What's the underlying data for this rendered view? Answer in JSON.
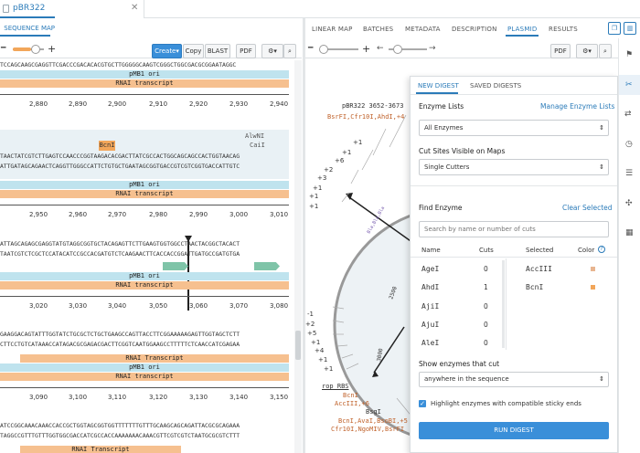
{
  "tab": {
    "title": "pBR322"
  },
  "left": {
    "title": "SEQUENCE MAP",
    "buttons": {
      "create": "Create",
      "copy": "Copy",
      "blast": "BLAST",
      "pdf": "PDF"
    }
  },
  "right_tabs": [
    "LINEAR MAP",
    "BATCHES",
    "METADATA",
    "DESCRIPTION",
    "PLASMID",
    "RESULTS"
  ],
  "right": {
    "pdf": "PDF"
  },
  "blocks": [
    {
      "ticks": [
        "2,880",
        "2,890",
        "2,900",
        "2,910",
        "2,920",
        "2,930",
        "2,940"
      ]
    },
    {
      "ticks": [
        "2,950",
        "2,960",
        "2,970",
        "2,980",
        "2,990",
        "3,000",
        "3,010"
      ]
    },
    {
      "ticks": [
        "3,020",
        "3,030",
        "3,040",
        "3,050",
        "3,060",
        "3,070",
        "3,080"
      ]
    },
    {
      "ticks": [
        "3,090",
        "3,100",
        "3,110",
        "3,120",
        "3,130",
        "3,140",
        "3,150"
      ]
    }
  ],
  "seqs": {
    "s0": "TCCAGCAAGCGAGGTTCGACCCGACACACGTGCTTGGGGGCAAGTCGGGCTGGCGACGCGGAATAGGC",
    "s1": "TAACTATCGTCTTGAGTCCAACCCGGTAAGACACGACTTATCGCCACTGGCAGCAGCCACTGGTAACAG",
    "s2": "ATTGATAGCAGAACTCAGGTTGGGCCATTCTGTGCTGAATAGCGGTGACCGTCGTCGGTGACCATTGTC",
    "s3": "ATTAGCAGAGCGAGGTATGTAGGCGGTGCTACAGAGTTCTTGAAGTGGTGGCCTAACTACGGCTACACT",
    "s4": "TAATCGTCTCGCTCCATACATCCGCCACGATGTCTCAAGAACTTCACCACCGGATTGATGCCGATGTGA",
    "s5": "GAAGGACAGTATTTGGTATCTGCGCTCTGCTGAAGCCAGTTACCTTCGGAAAAAGAGTTGGTAGCTCTT",
    "s6": "CTTCCTGTCATAAACCATAGACGCGAGACGACTTCGGTCAATGGAAGCCTTTTTCTCAACCATCGAGAA",
    "s7": "ATCCGGCAAACAAACCACCGCTGGTAGCGGTGGTTTTTTTGTTTGCAAGCAGCAGATTACGCGCAGAAA",
    "s8": "TAGGCCGTTTGTTTGGTGGCGACCATCGCCACCAAAAAAACAAACGTTCGTCGTCTAATGCGCGTCTTT"
  },
  "features": {
    "ori": "pMB1 ori",
    "rnai": "RNAI transcript",
    "rnai2": "RNAI Transcript",
    "bcni": "BcnI",
    "alwni": "AlwNI",
    "caii": "CaiI"
  },
  "plasmid": {
    "title": "pBR322 3652-3673",
    "sub": "BsrFI,Cfr10I,AhdI,+4",
    "plus": [
      "+1",
      "+1",
      "+6",
      "+2",
      "+3",
      "+1",
      "+1",
      "+1",
      "-1",
      "+2",
      "+5",
      "+1",
      "+4",
      "+1",
      "+1"
    ],
    "inner": "2500",
    "inner2": "3000",
    "rop": "rop RBS",
    "bcni": "BcnI",
    "accIII": "AccIII,+6",
    "bsgi": "BsgI",
    "sites1": "BcnI,AvaI,BsoBI,+5",
    "sites2": "Cfr10I,NgoMIV,BsrFI"
  },
  "digest": {
    "tabs": [
      "NEW DIGEST",
      "SAVED DIGESTS"
    ],
    "enzyme_lists_label": "Enzyme Lists",
    "manage": "Manage Enzyme Lists",
    "enzyme_list_value": "All Enzymes",
    "cut_sites_label": "Cut Sites Visible on Maps",
    "cut_sites_value": "Single Cutters",
    "find_label": "Find Enzyme",
    "clear": "Clear Selected",
    "search_placeholder": "Search by name or number of cuts",
    "headers": {
      "name": "Name",
      "cuts": "Cuts",
      "selected": "Selected",
      "color": "Color"
    },
    "rows": [
      {
        "name": "AgeI",
        "cuts": "0"
      },
      {
        "name": "AhdI",
        "cuts": "1"
      },
      {
        "name": "AjiI",
        "cuts": "0"
      },
      {
        "name": "AjuI",
        "cuts": "0"
      },
      {
        "name": "AleI",
        "cuts": "0"
      }
    ],
    "selected": [
      {
        "name": "AccIII",
        "color": "#e8b590"
      },
      {
        "name": "BcnI",
        "color": "#f2a65a"
      }
    ],
    "show_label": "Show enzymes that cut",
    "show_value": "anywhere in the sequence",
    "highlight": "Highlight enzymes with compatible sticky ends",
    "run": "RUN DIGEST"
  }
}
